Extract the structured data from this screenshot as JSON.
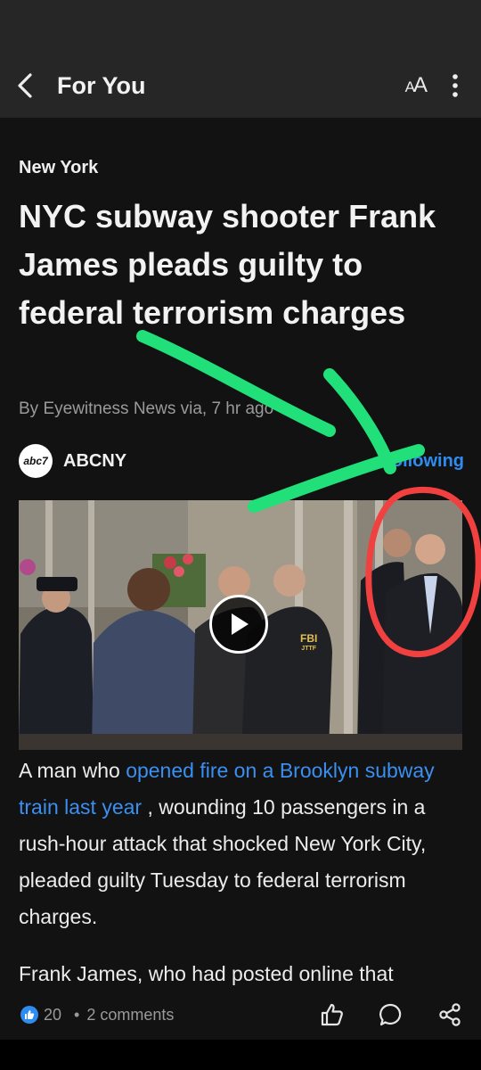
{
  "appbar": {
    "title": "For You",
    "text_size_label_small": "A",
    "text_size_label_large": "A"
  },
  "article": {
    "category": "New York",
    "headline": "NYC subway shooter Frank James pleads guilty to federal terrorism charges",
    "byline": "By Eyewitness News via, 7 hr ago",
    "source": {
      "logo_text": "abc7",
      "name": "ABCNY",
      "follow_label": "Following"
    },
    "photo": {
      "badge_text": "FBI",
      "badge_sub": "JTTF"
    },
    "para1": {
      "before": "A man who ",
      "link": "opened fire on a Brooklyn subway train last year",
      "after": " , wounding 10 passengers in a rush-hour attack that shocked New York City, pleaded guilty Tuesday to federal terrorism charges."
    },
    "para2": "Frank James, who had posted online that"
  },
  "bottom": {
    "likes": "20",
    "separator": "•",
    "comments": "2 comments"
  },
  "colors": {
    "accent": "#2e8cf0",
    "link": "#3b8ff0",
    "annotation_green": "#21e07a",
    "annotation_red": "#f04040"
  }
}
